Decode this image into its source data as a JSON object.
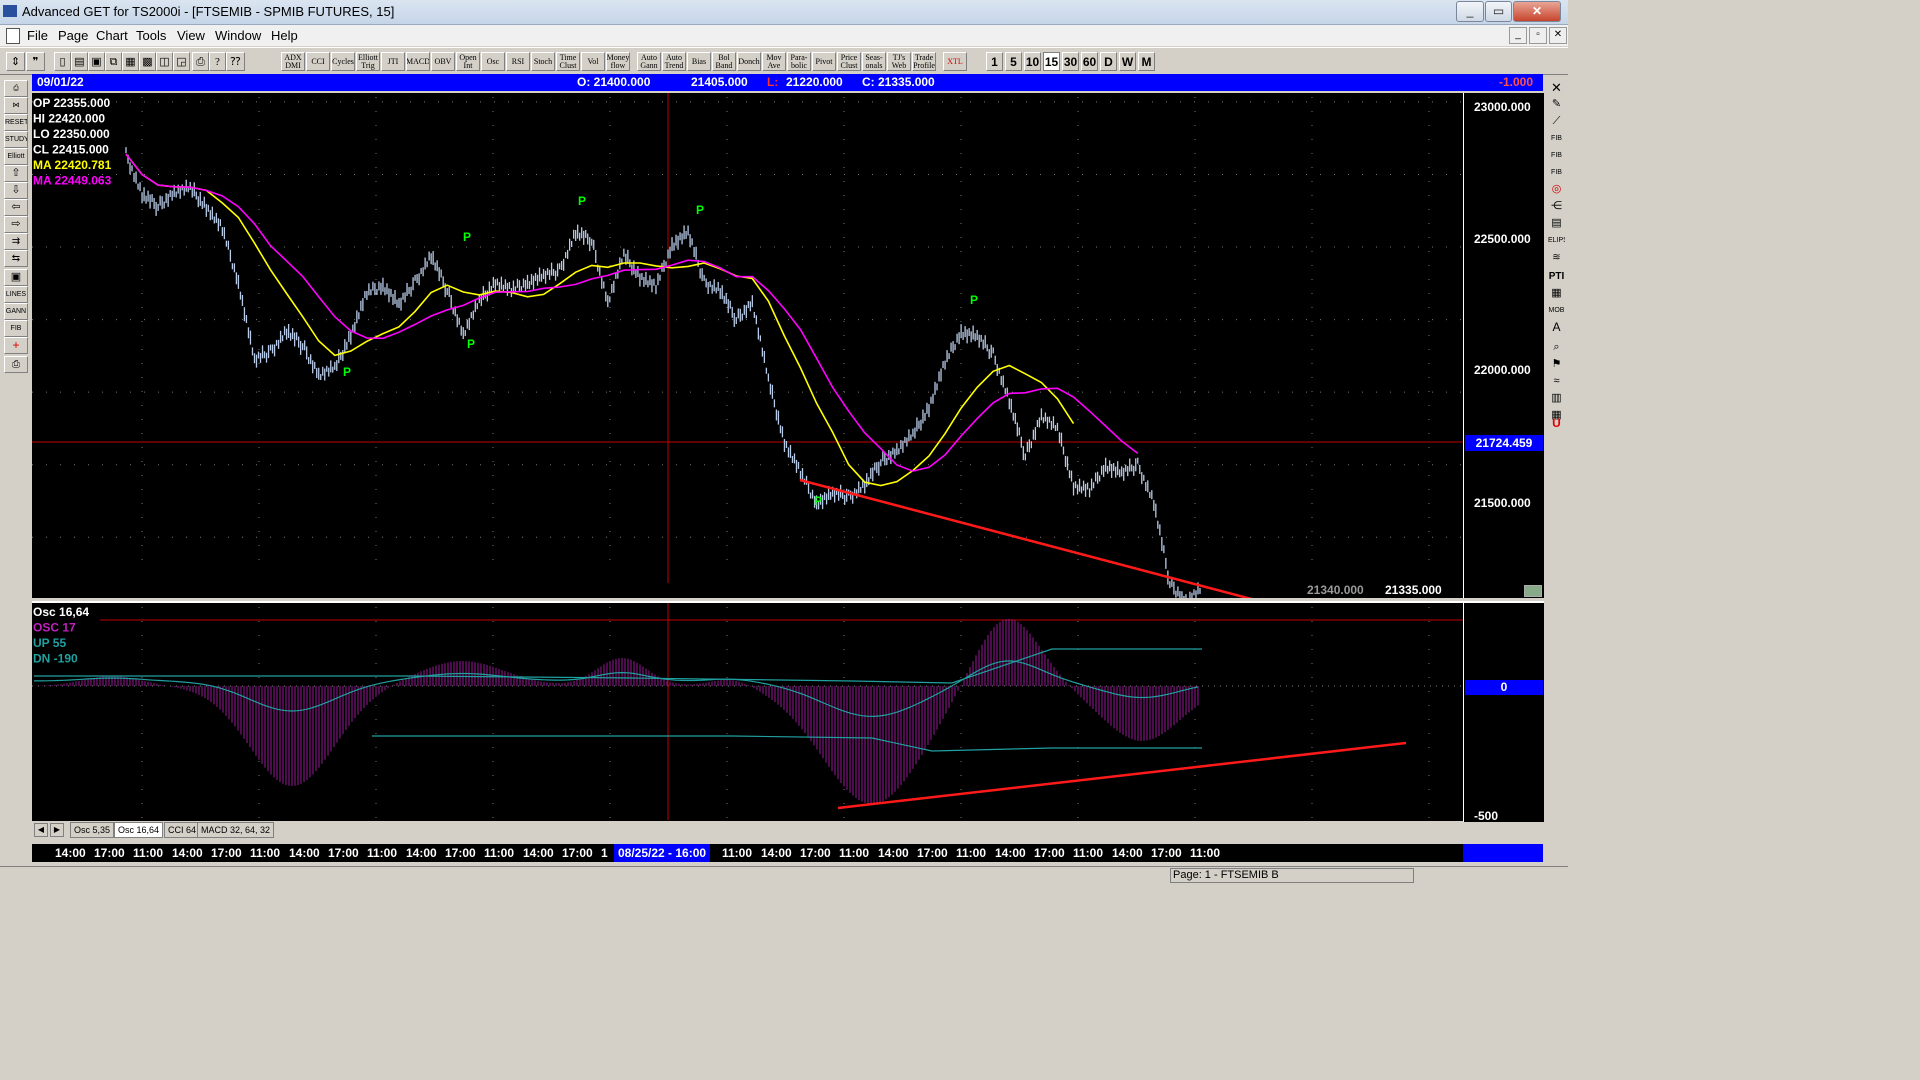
{
  "window": {
    "title": "Advanced GET for TS2000i - [FTSEMIB - SPMIB FUTURES, 15]",
    "controls": [
      "_",
      "▭",
      "✕"
    ]
  },
  "menu": {
    "items": [
      "File",
      "Page",
      "Chart",
      "Tools",
      "View",
      "Window",
      "Help"
    ],
    "mdi_controls": [
      "_",
      "▫",
      "✕"
    ]
  },
  "toolbar": {
    "study_buttons": [
      "ADX DMI",
      "CCI",
      "Cycles",
      "Elliott Trig",
      "JTI",
      "MACD",
      "OBV",
      "Open Int",
      "Osc",
      "RSI",
      "Stoch",
      "Time Clust",
      "Vol",
      "Money flow",
      "Auto Gann",
      "Auto Trend",
      "Bias",
      "Bol Band",
      "Donch",
      "Mov Ave",
      "Para-bolic",
      "Pivot",
      "Price Clust",
      "Seas-onals",
      "TJ's Web",
      "Trade Profile",
      "XTL"
    ],
    "periods": [
      "1",
      "5",
      "10",
      "15",
      "30",
      "60",
      "D",
      "W",
      "M"
    ],
    "active_period": "15"
  },
  "infobar": {
    "date": "09/01/22",
    "open": "O: 21400.000",
    "high": "21405.000",
    "low_label": "L:",
    "low": "21220.000",
    "close": "C: 21335.000",
    "change": "-1.000",
    "colors": {
      "bar": "#0000ff",
      "low_label": "#ff0000",
      "change": "#ff4040"
    }
  },
  "price_panel": {
    "legend": [
      {
        "label": "OP",
        "value": "22355.000",
        "color": "#ffffff"
      },
      {
        "label": "HI",
        "value": "22420.000",
        "color": "#ffffff"
      },
      {
        "label": "LO",
        "value": "22350.000",
        "color": "#ffffff"
      },
      {
        "label": "CL",
        "value": "22415.000",
        "color": "#ffffff"
      },
      {
        "label": "MA",
        "value": "22420.781",
        "color": "#ffff00"
      },
      {
        "label": "MA",
        "value": "22449.063",
        "color": "#ff00ff"
      }
    ],
    "price_axis": [
      "23000.000",
      "22500.000",
      "22000.000",
      "21500.000"
    ],
    "cursor_price": "21724.459",
    "bottom_values": [
      "21340.000",
      "21335.000"
    ],
    "pivot_marker": "P"
  },
  "osc_panel": {
    "legend": [
      {
        "label": "Osc 16,64",
        "value": "",
        "color": "#ffffff"
      },
      {
        "label": "OSC",
        "value": "17",
        "color": "#c020c0"
      },
      {
        "label": "UP",
        "value": "55",
        "color": "#20a0a0"
      },
      {
        "label": "DN",
        "value": "-190",
        "color": "#20a0a0"
      }
    ],
    "axis": [
      "0",
      "-500"
    ]
  },
  "tabs": [
    "Osc 5,35",
    "Osc 16,64",
    "CCI 64",
    "MACD 32, 64, 32"
  ],
  "active_tab": "Osc 16,64",
  "time_axis": {
    "labels": [
      "14:00",
      "17:00",
      "11:00",
      "14:00",
      "17:00",
      "11:00",
      "14:00",
      "17:00",
      "11:00",
      "14:00",
      "17:00",
      "11:00",
      "14:00",
      "17:00",
      "1"
    ],
    "cursor_label": "08/25/22 - 16:00",
    "labels_after": [
      "11:00",
      "14:00",
      "17:00",
      "11:00",
      "14:00",
      "17:00",
      "11:00",
      "14:00",
      "17:00",
      "11:00",
      "14:00",
      "17:00",
      "11:00"
    ]
  },
  "status": {
    "page": "Page: 1 - FTSEMIB B"
  },
  "chart_data": {
    "type": "line",
    "price_series": {
      "name": "",
      "y": [
        22820,
        22680,
        22640,
        22690,
        22700,
        22640,
        22560,
        22380,
        22110,
        22140,
        22210,
        22160,
        22060,
        22080,
        22200,
        22340,
        22370,
        22300,
        22380,
        22470,
        22350,
        22200,
        22310,
        22380,
        22350,
        22380,
        22400,
        22420,
        22550,
        22520,
        22310,
        22470,
        22400,
        22360,
        22510,
        22550,
        22380,
        22350,
        22250,
        22310,
        22040,
        21830,
        21720,
        21620,
        21650,
        21640,
        21680,
        21760,
        21800,
        21850,
        21950,
        22100,
        22210,
        22190,
        22130,
        21970,
        21780,
        21920,
        21870,
        21680,
        21660,
        21750,
        21720,
        21750,
        21620,
        21340,
        21280,
        21320
      ]
    },
    "ma_yellow_current": "22420.781",
    "ma_magenta_current": "22449.063",
    "ylim": [
      21270,
      23010
    ]
  }
}
